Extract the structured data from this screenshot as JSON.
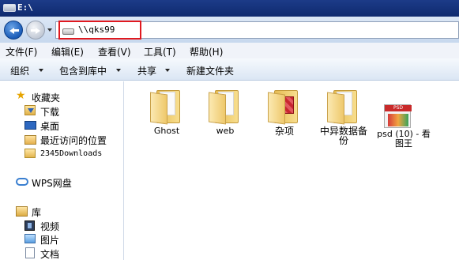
{
  "window": {
    "title": "E:\\"
  },
  "address": {
    "path": "\\\\qks99"
  },
  "menu": [
    "文件(F)",
    "编辑(E)",
    "查看(V)",
    "工具(T)",
    "帮助(H)"
  ],
  "toolbar": [
    "组织",
    "包含到库中",
    "共享",
    "新建文件夹"
  ],
  "sidebar": {
    "favorites_label": "收藏夹",
    "favorites": [
      "下载",
      "桌面",
      "最近访问的位置",
      "2345Downloads"
    ],
    "wps_label": "WPS网盘",
    "library_label": "库",
    "library": [
      "视频",
      "图片",
      "文档"
    ]
  },
  "files": [
    {
      "name": "Ghost",
      "icon": "folder-icon"
    },
    {
      "name": "web",
      "icon": "folder-icon"
    },
    {
      "name": "杂项",
      "icon": "folder-red-icon"
    },
    {
      "name": "中异数据备份",
      "icon": "folder-icon"
    },
    {
      "name": "psd (10) - 看图王",
      "icon": "psd-file-icon"
    }
  ],
  "psd_thumb_text": "PSD"
}
